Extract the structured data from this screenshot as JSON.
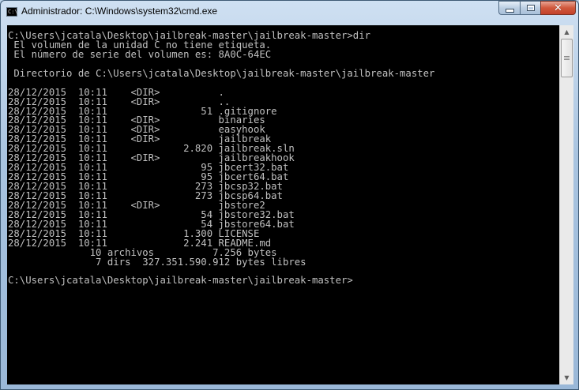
{
  "window": {
    "title": "Administrador: C:\\Windows\\system32\\cmd.exe",
    "icon": "cmd-icon",
    "icon_text": "C:\\",
    "close_glyph": "✕"
  },
  "colors": {
    "console_bg": "#000000",
    "console_fg": "#c0c0c0",
    "close_button": "#c3412a"
  },
  "console": {
    "lines": [
      "C:\\Users\\jcatala\\Desktop\\jailbreak-master\\jailbreak-master>dir",
      " El volumen de la unidad C no tiene etiqueta.",
      " El número de serie del volumen es: 8A0C-64EC",
      "",
      " Directorio de C:\\Users\\jcatala\\Desktop\\jailbreak-master\\jailbreak-master",
      "",
      "28/12/2015  10:11    <DIR>          .",
      "28/12/2015  10:11    <DIR>          ..",
      "28/12/2015  10:11                51 .gitignore",
      "28/12/2015  10:11    <DIR>          binaries",
      "28/12/2015  10:11    <DIR>          easyhook",
      "28/12/2015  10:11    <DIR>          jailbreak",
      "28/12/2015  10:11             2.820 jailbreak.sln",
      "28/12/2015  10:11    <DIR>          jailbreakhook",
      "28/12/2015  10:11                95 jbcert32.bat",
      "28/12/2015  10:11                95 jbcert64.bat",
      "28/12/2015  10:11               273 jbcsp32.bat",
      "28/12/2015  10:11               273 jbcsp64.bat",
      "28/12/2015  10:11    <DIR>          jbstore2",
      "28/12/2015  10:11                54 jbstore32.bat",
      "28/12/2015  10:11                54 jbstore64.bat",
      "28/12/2015  10:11             1.300 LICENSE",
      "28/12/2015  10:11             2.241 README.md",
      "              10 archivos          7.256 bytes",
      "               7 dirs  327.351.590.912 bytes libres",
      "",
      "C:\\Users\\jcatala\\Desktop\\jailbreak-master\\jailbreak-master>"
    ]
  },
  "scrollbar": {
    "up_icon": "scroll-up-arrow-icon",
    "down_icon": "scroll-down-arrow-icon",
    "up_glyph": "▲",
    "down_glyph": "▼"
  }
}
